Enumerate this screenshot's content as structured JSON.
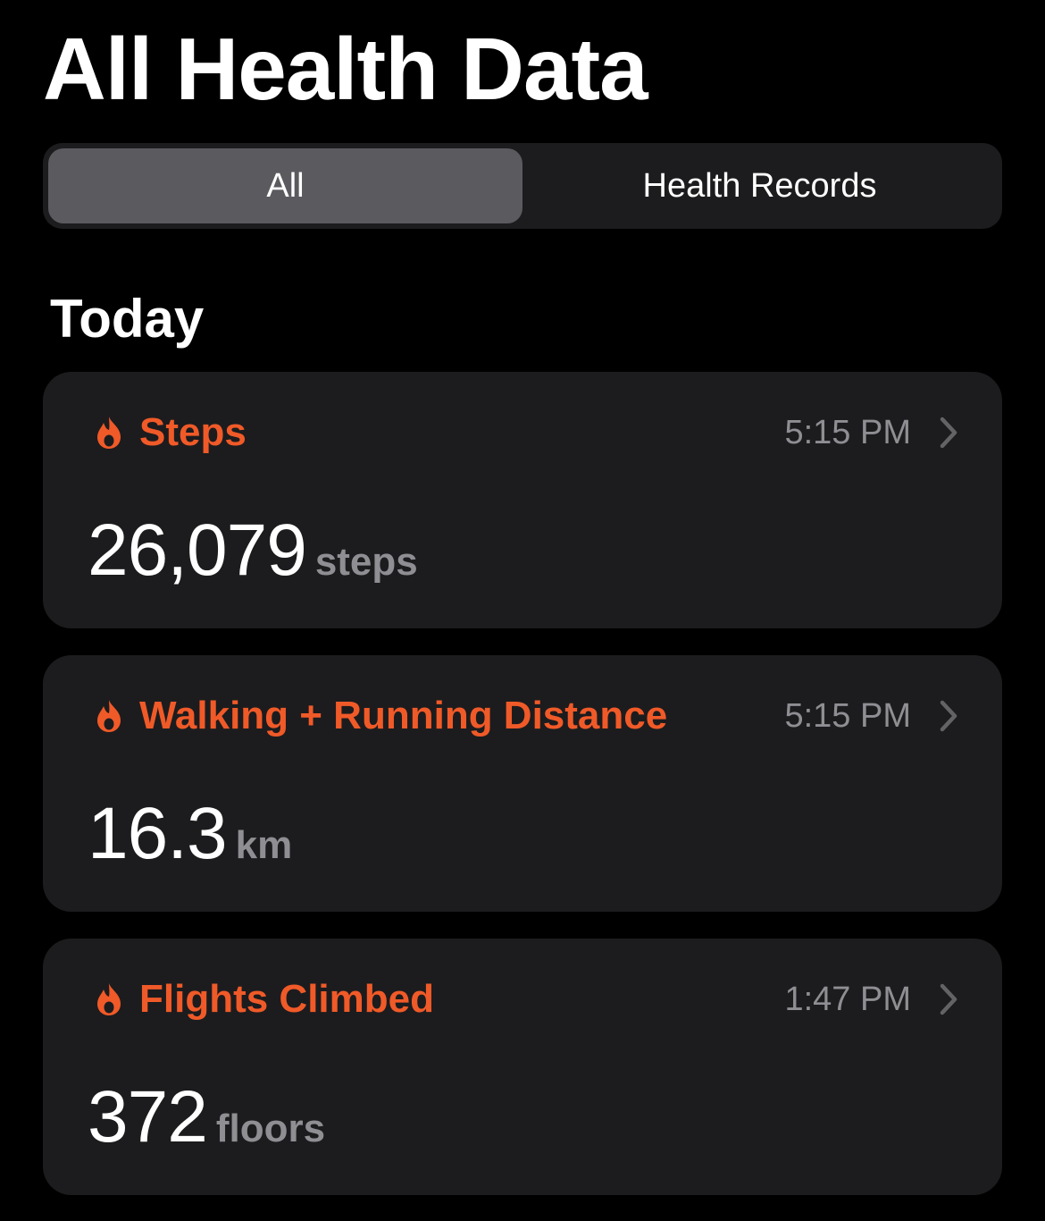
{
  "header": {
    "title": "All Health Data"
  },
  "segmented_control": {
    "options": [
      {
        "label": "All",
        "selected": true
      },
      {
        "label": "Health Records",
        "selected": false
      }
    ]
  },
  "section": {
    "title": "Today"
  },
  "cards": [
    {
      "icon": "flame-icon",
      "title": "Steps",
      "time": "5:15 PM",
      "value": "26,079",
      "unit": "steps"
    },
    {
      "icon": "flame-icon",
      "title": "Walking + Running Distance",
      "time": "5:15 PM",
      "value": "16.3",
      "unit": "km"
    },
    {
      "icon": "flame-icon",
      "title": "Flights Climbed",
      "time": "1:47 PM",
      "value": "372",
      "unit": "floors"
    }
  ],
  "colors": {
    "background": "#000000",
    "card": "#1c1c1e",
    "accent": "#f05a28",
    "secondary_text": "#8e8e93",
    "segment_selected": "#5a5a5f"
  }
}
